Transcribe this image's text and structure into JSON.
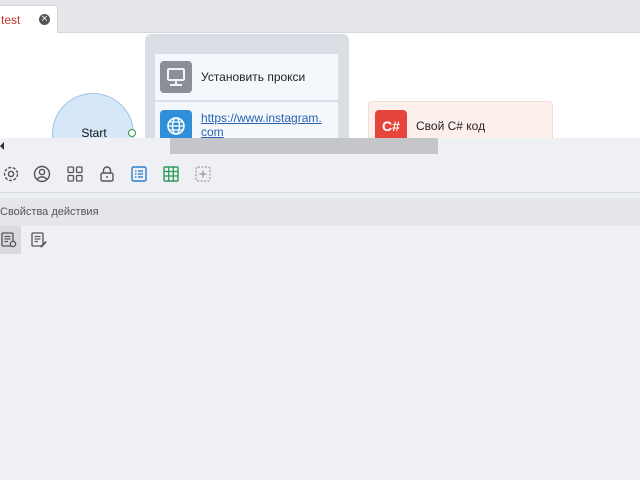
{
  "tabs": [
    {
      "label": "test",
      "active": true,
      "close_icon": "close-circle-icon"
    }
  ],
  "canvas": {
    "start_node": {
      "label": "Start"
    },
    "group_blocks": [
      {
        "label": "Установить прокси",
        "icon": "monitor-icon"
      },
      {
        "label": "https://www.instagram.com",
        "icon": "globe-icon"
      }
    ],
    "csharp_block": {
      "label": "Свой C# код",
      "icon_text": "C#"
    }
  },
  "toolbar": {
    "buttons": [
      {
        "name": "settings",
        "icon": "gear-icon"
      },
      {
        "name": "profile",
        "icon": "user-circle-icon"
      },
      {
        "name": "apps",
        "icon": "grid-icon"
      },
      {
        "name": "lock",
        "icon": "lock-icon"
      },
      {
        "name": "list",
        "icon": "list-icon"
      },
      {
        "name": "table",
        "icon": "table-icon"
      },
      {
        "name": "add",
        "icon": "add-dashed-icon"
      }
    ]
  },
  "properties": {
    "title": "Свойства действия",
    "tabs": [
      {
        "name": "action-settings",
        "icon": "doc-gear-icon",
        "active": true
      },
      {
        "name": "action-notes",
        "icon": "doc-edit-icon",
        "active": false
      }
    ]
  },
  "colors": {
    "tab_text": "#c0392b",
    "start_fill": "#d6e8f7",
    "csharp_red": "#e5453b",
    "link_blue": "#2762b0",
    "accent_blue": "#2f7fd1",
    "accent_green": "#2e9a5a"
  }
}
